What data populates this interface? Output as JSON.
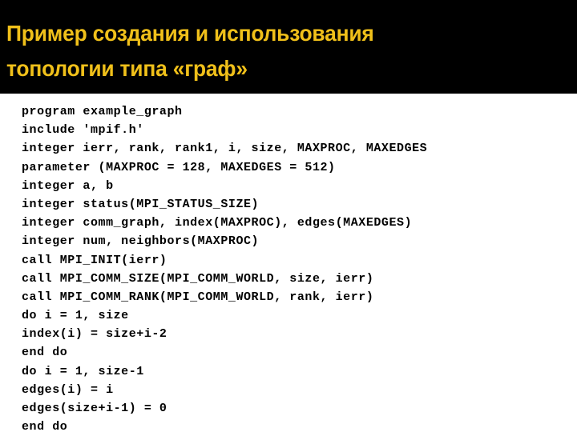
{
  "slide": {
    "background_color": "#ffffff",
    "title_band_color": "#000000",
    "title_color": "#f0c01a",
    "code_color": "#000000"
  },
  "title": {
    "line1": "Пример создания и использования",
    "line2": "топологии типа «граф»",
    "full": "Пример создания и использования топологии типа «граф»"
  },
  "code": {
    "language": "Fortran",
    "lines": [
      "program example_graph",
      "include 'mpif.h'",
      "integer ierr, rank, rank1, i, size, MAXPROC, MAXEDGES",
      "parameter (MAXPROC = 128, MAXEDGES = 512)",
      "integer a, b",
      "integer status(MPI_STATUS_SIZE)",
      "integer comm_graph, index(MAXPROC), edges(MAXEDGES)",
      "integer num, neighbors(MAXPROC)",
      "call MPI_INIT(ierr)",
      "call MPI_COMM_SIZE(MPI_COMM_WORLD, size, ierr)",
      "call MPI_COMM_RANK(MPI_COMM_WORLD, rank, ierr)",
      "do i = 1, size",
      "index(i) = size+i-2",
      "end do",
      "do i = 1, size-1",
      "edges(i) = i",
      "edges(size+i-1) = 0",
      "end do"
    ]
  }
}
